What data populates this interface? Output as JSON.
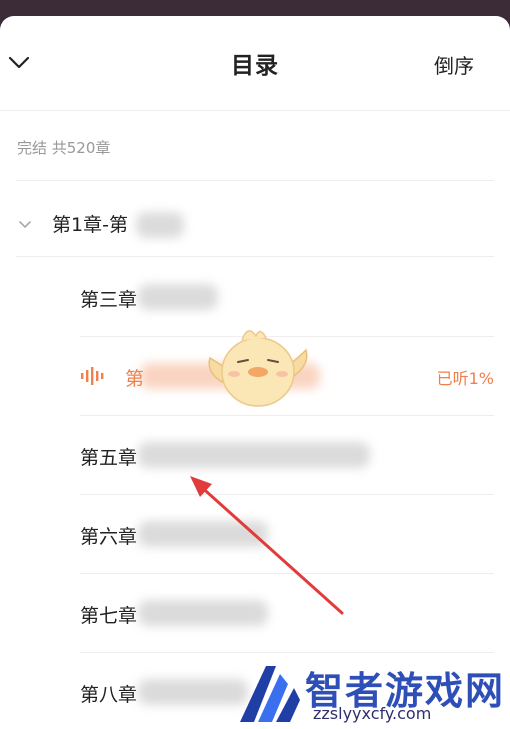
{
  "header": {
    "title": "目录",
    "sort_label": "倒序"
  },
  "book_status": "完结 共520章",
  "volume": {
    "title": "第1章-第"
  },
  "chapters": [
    {
      "title": "第三章",
      "active": false
    },
    {
      "title": "第",
      "active": true,
      "progress": "已听1%"
    },
    {
      "title": "第五章",
      "active": false
    },
    {
      "title": "第六章",
      "active": false
    },
    {
      "title": "第七章",
      "active": false
    },
    {
      "title": "第八章",
      "active": false
    }
  ],
  "watermark": {
    "brand": "智者游戏网",
    "url": "zzslyyxcfy.com"
  },
  "colors": {
    "accent": "#f07f4c",
    "text": "#222222",
    "muted": "#999999"
  }
}
